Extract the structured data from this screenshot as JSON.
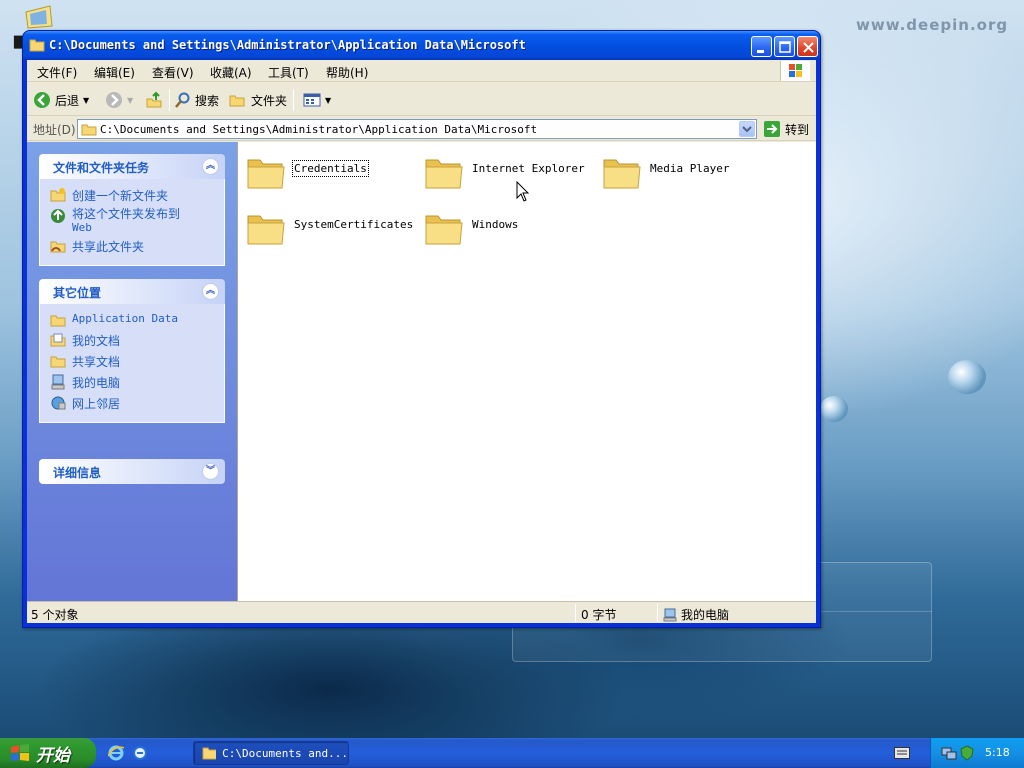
{
  "desktop": {
    "watermark": "www.deepin.org"
  },
  "window": {
    "title": "C:\\Documents and Settings\\Administrator\\Application Data\\Microsoft",
    "menu": [
      "文件(F)",
      "编辑(E)",
      "查看(V)",
      "收藏(A)",
      "工具(T)",
      "帮助(H)"
    ],
    "toolbar": {
      "back_label": "后退",
      "search_label": "搜索",
      "folders_label": "文件夹"
    },
    "address": {
      "label": "地址(D)",
      "value": "C:\\Documents and Settings\\Administrator\\Application Data\\Microsoft",
      "go_label": "转到"
    }
  },
  "taskpane": {
    "tasks": {
      "title": "文件和文件夹任务",
      "items": [
        "创建一个新文件夹",
        "将这个文件夹发布到",
        "Web",
        "共享此文件夹"
      ]
    },
    "places": {
      "title": "其它位置",
      "items": [
        "Application Data",
        "我的文档",
        "共享文档",
        "我的电脑",
        "网上邻居"
      ]
    },
    "details": {
      "title": "详细信息"
    }
  },
  "folders": [
    "Credentials",
    "Internet Explorer",
    "Media Player",
    "SystemCertificates",
    "Windows"
  ],
  "statusbar": {
    "objects": "5 个对象",
    "size": "0 字节",
    "location": "我的电脑"
  },
  "taskbar": {
    "start_label": "开始",
    "task_label": "C:\\Documents and...",
    "clock": "5:18"
  },
  "colors": {
    "titlebar": "#0350e0",
    "taskpane": "#6f8fe0",
    "link": "#215dc6",
    "taskbar": "#245edb",
    "start": "#2f9b2f"
  }
}
